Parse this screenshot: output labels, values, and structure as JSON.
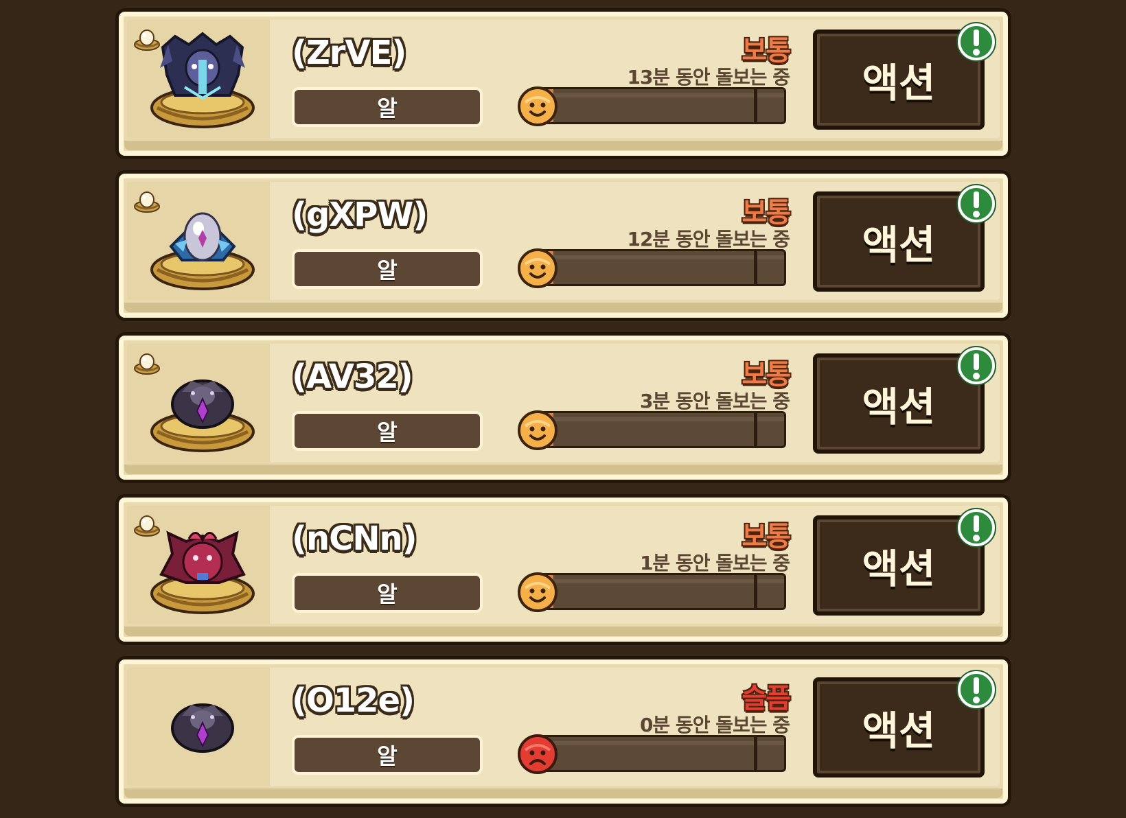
{
  "rows": [
    {
      "name": "(ZrVE)",
      "type": "알",
      "mood": "보통",
      "care_time": "13분 동안 돌보는 중",
      "action": "액션",
      "mood_level": 0.05,
      "face": "happy",
      "creature": "dragon",
      "nest": true
    },
    {
      "name": "(gXPW)",
      "type": "알",
      "mood": "보통",
      "care_time": "12분 동안 돌보는 중",
      "action": "액션",
      "mood_level": 0.05,
      "face": "happy",
      "creature": "crystal",
      "nest": true
    },
    {
      "name": "(AV32)",
      "type": "알",
      "mood": "보통",
      "care_time": "3분 동안 돌보는 중",
      "action": "액션",
      "mood_level": 0.05,
      "face": "happy",
      "creature": "dark-egg",
      "nest": true
    },
    {
      "name": "(nCNn)",
      "type": "알",
      "mood": "보통",
      "care_time": "1분 동안 돌보는 중",
      "action": "액션",
      "mood_level": 0.05,
      "face": "happy",
      "creature": "winged",
      "nest": true
    },
    {
      "name": "(O12e)",
      "type": "알",
      "mood": "슬픔",
      "care_time": "0분 동안 돌보는 중",
      "action": "액션",
      "mood_level": 0.0,
      "face": "sad",
      "creature": "dark-egg",
      "nest": false
    }
  ],
  "colors": {
    "mood_normal": "#ef7a43",
    "mood_sad": "#e63d32",
    "alert_green": "#2e8a3c"
  },
  "icons": {
    "egg_badge": "egg-nest-icon",
    "alert": "exclamation-icon",
    "face_happy": "smiley-face-icon",
    "face_sad": "sad-face-icon"
  }
}
